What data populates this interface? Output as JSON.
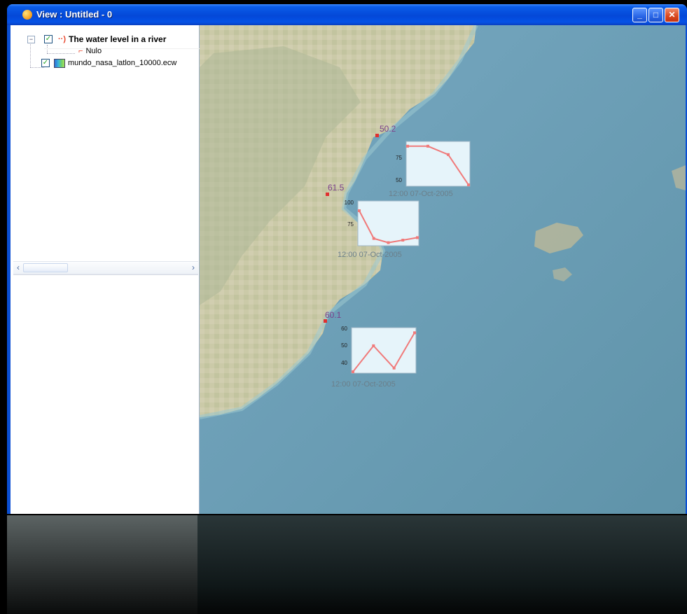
{
  "window": {
    "title": "View : Untitled - 0",
    "buttons": {
      "minimize": "_",
      "maximize": "□",
      "close": "✕"
    }
  },
  "toc": {
    "layers": [
      {
        "name": "The water level in a river",
        "checked": true,
        "expanded": true,
        "icon": "water-wave-icon",
        "legend": "Nulo",
        "legend_icon": "marker-icon"
      },
      {
        "name": "mundo_nasa_latlon_10000.ecw",
        "checked": true,
        "icon": "raster-icon"
      }
    ],
    "scroll": {
      "left": "‹",
      "right": "›"
    }
  },
  "map": {
    "points": [
      {
        "value": "50.2",
        "chart_time": "12:00 07-Oct-2005",
        "ticks": [
          "75",
          "50"
        ],
        "chart_values": [
          96,
          96,
          86,
          50
        ]
      },
      {
        "value": "61.5",
        "chart_time": "12:00 07-Oct-2005",
        "ticks": [
          "100",
          "75"
        ],
        "chart_values": [
          100,
          67,
          62,
          65,
          68
        ]
      },
      {
        "value": "60.1",
        "chart_time": "12:00 07-Oct-2005",
        "ticks": [
          "60",
          "50",
          "40"
        ],
        "chart_values": [
          37,
          51,
          39,
          58
        ]
      }
    ],
    "colors": {
      "sea": "#6c9eb6",
      "land": "#c9c9a8",
      "chart_line": "#f07a7a",
      "chart_bg": "#e6f4fa",
      "point_label": "#7a3f8a"
    }
  }
}
